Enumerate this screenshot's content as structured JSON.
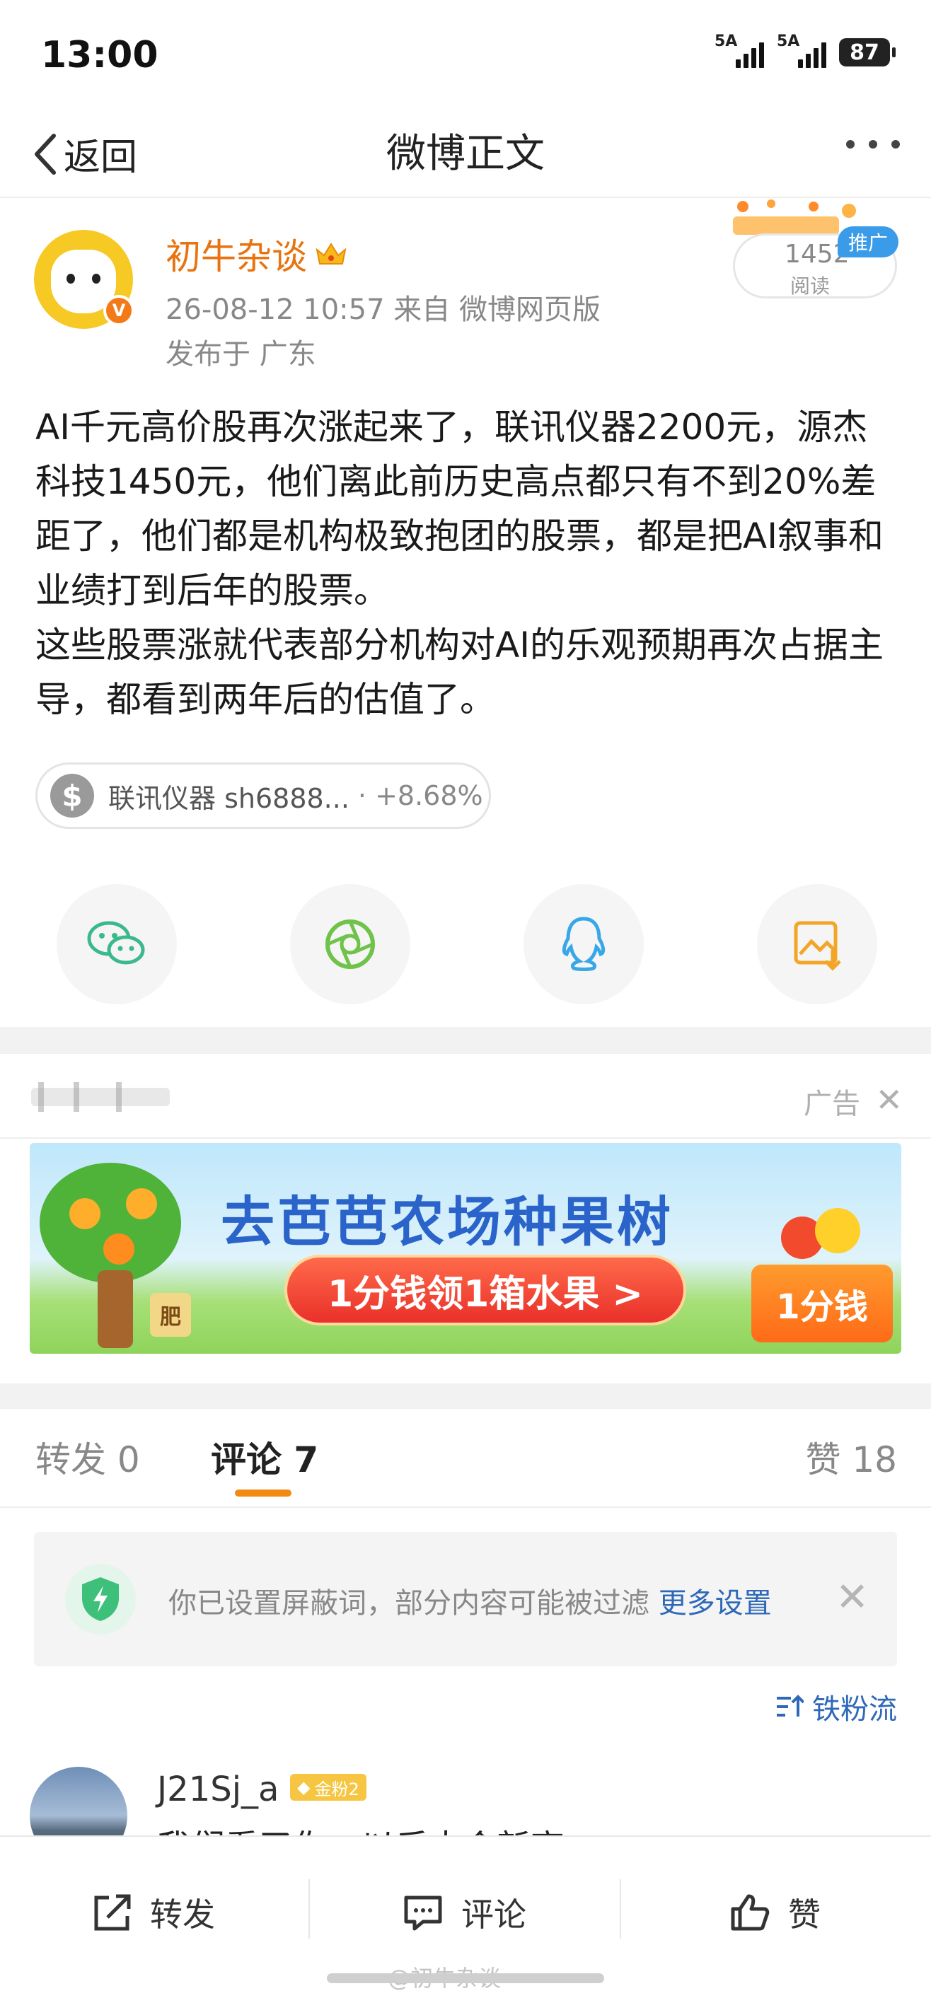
{
  "status_bar": {
    "time": "13:00",
    "signal1": "5A",
    "signal2": "5A",
    "battery": "87"
  },
  "nav": {
    "back_label": "返回",
    "title": "微博正文"
  },
  "author": {
    "name": "初牛杂谈",
    "meta": "26-08-12 10:57  来自 微博网页版",
    "location": "发布于 广东",
    "verified_mark": "V",
    "read_count": "1452",
    "read_label": "阅读",
    "promo_tag": "推广"
  },
  "post": {
    "text": "AI千元高价股再次涨起来了，联讯仪器2200元，源杰科技1450元，他们离此前历史高点都只有不到20%差距了，他们都是机构极致抱团的股票，都是把AI叙事和业绩打到后年的股票。\n这些股票涨就代表部分机构对AI的乐观预期再次占据主导，都看到两年后的估值了。"
  },
  "stock": {
    "icon": "$",
    "label": "联讯仪器 sh6888...",
    "change": "· +8.68%"
  },
  "share_icons": [
    "wechat-icon",
    "moments-icon",
    "qq-icon",
    "save-image-icon"
  ],
  "ad": {
    "label": "广告",
    "title": "去芭芭农场种果树",
    "cta": "1分钱领1箱水果 >",
    "price": "1分钱",
    "fertilizer": "肥"
  },
  "tabs": [
    {
      "label": "转发 0"
    },
    {
      "label": "评论 7"
    },
    {
      "label": "赞 18"
    }
  ],
  "notice": {
    "text": "你已设置屏蔽词，部分内容可能被过滤",
    "link": "更多设置"
  },
  "sort": {
    "label": "铁粉流"
  },
  "comment": {
    "user": "J21Sj_a",
    "badge": "金粉2",
    "text": "我们看了你，以后大会新高"
  },
  "bottom_bar": {
    "repost": "转发",
    "comment": "评论",
    "like": "赞"
  },
  "watermark": "@初牛杂谈",
  "colors": {
    "accent_orange": "#e8730f",
    "link_blue": "#2e68b8",
    "tab_underline": "#f08a14"
  }
}
